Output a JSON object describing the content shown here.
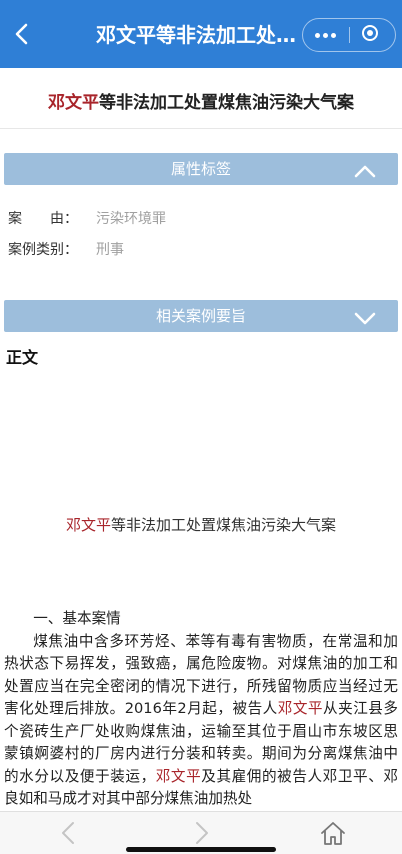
{
  "topbar": {
    "back_icon": "chevron-left-icon",
    "title": "邓文平等非法加工处置煤焦油污染大气案",
    "more_icon": "more-dots-icon",
    "close_icon": "miniprogram-close-icon",
    "color": "#2f7fd6"
  },
  "case_title": {
    "highlight": "邓文平",
    "rest": "等非法加工处置煤焦油污染大气案"
  },
  "attributes_panel": {
    "label": "属性标签",
    "state_icon": "chevron-up-icon",
    "rows": [
      {
        "key": "案　　由：",
        "value": "污染环境罪"
      },
      {
        "key": "案例类别：",
        "value": "刑事"
      }
    ]
  },
  "related_panel": {
    "label": "相关案例要旨",
    "state_icon": "chevron-down-icon"
  },
  "body": {
    "section_label": "正文",
    "title_highlight": "邓文平",
    "title_rest": "等非法加工处置煤焦油污染大气案",
    "heading": "一、基本案情",
    "p1_part1": "煤焦油中含多环芳烃、苯等有毒有害物质，在常温和加热状态下易挥发，强致癌，属危险废物。对煤焦油的加工和处置应当在完全密闭的情况下进行，所残留物质应当经过无害化处理后排放。2016年2月起，被告人",
    "name": "邓文平",
    "p1_part2": "从夹江县多个瓷砖生产厂处收购煤焦油，运输至其位于眉山市东坡区思蒙镇婀婆村的厂房内进行分装和转卖。期间为分离煤焦油中的水分以及便于装运，",
    "p1_part3": "及其雇佣的被告人邓卫平、邓良如和马成才对其中部分煤焦油加热处"
  },
  "bottom_nav": {
    "back_icon": "arrow-left-icon",
    "forward_icon": "arrow-right-icon",
    "home_icon": "home-icon"
  },
  "colors": {
    "highlight": "#a8242a",
    "panel": "#9dbedc",
    "muted_value": "#a0a0a0"
  }
}
